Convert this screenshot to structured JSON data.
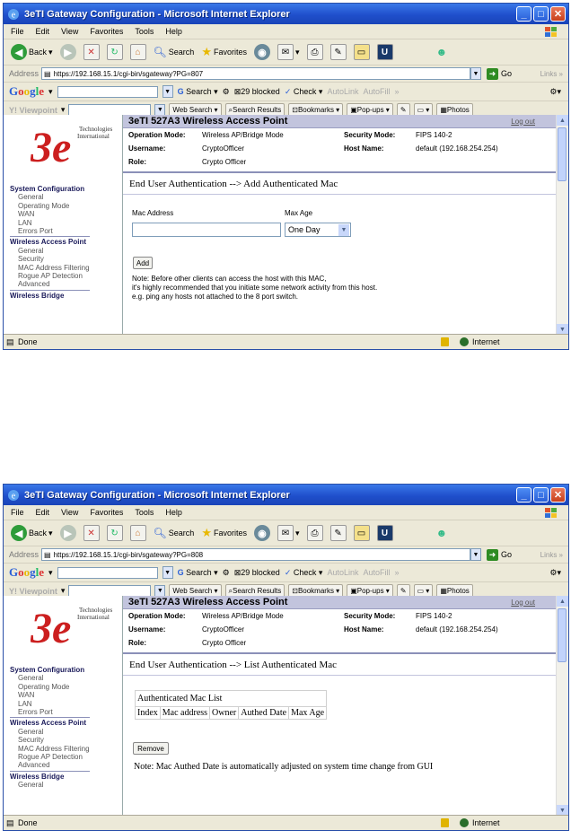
{
  "windows": [
    {
      "title": "3eTI Gateway Configuration - Microsoft Internet Explorer",
      "menu": [
        "File",
        "Edit",
        "View",
        "Favorites",
        "Tools",
        "Help"
      ],
      "toolbar": {
        "back": "Back",
        "search": "Search",
        "favorites": "Favorites"
      },
      "address": {
        "label": "Address",
        "url": "https://192.168.15.1/cgi-bin/sgateway?PG=807",
        "go": "Go",
        "links": "Links"
      },
      "google": {
        "logo": "Google",
        "search": "Search",
        "blocked": "29 blocked",
        "check": "Check",
        "autolink": "AutoLink",
        "autofill": "AutoFill"
      },
      "yahoo": {
        "logo": "Y! Viewpoint",
        "websearch": "Web Search",
        "results": "Search Results",
        "bookmarks": "Bookmarks",
        "popups": "Pop-ups",
        "photos": "Photos"
      },
      "status": {
        "left": "Done",
        "zone": "Internet"
      },
      "page": {
        "logo_text": "Technologies International",
        "logo_mark": "3e",
        "header_title": "3eTI 527A3 Wireless Access Point",
        "logout": "Log out",
        "info": {
          "op_mode_label": "Operation Mode:",
          "op_mode_value": "Wireless AP/Bridge Mode",
          "user_label": "Username:",
          "user_value": "CryptoOfficer",
          "role_label": "Role:",
          "role_value": "Crypto Officer",
          "sec_label": "Security Mode:",
          "sec_value": "FIPS 140-2",
          "host_label": "Host Name:",
          "host_value": "default (192.168.254.254)"
        },
        "nav": [
          {
            "type": "hd",
            "label": "System Configuration"
          },
          {
            "type": "it",
            "label": "General"
          },
          {
            "type": "it",
            "label": "Operating Mode"
          },
          {
            "type": "it",
            "label": "WAN"
          },
          {
            "type": "it",
            "label": "LAN"
          },
          {
            "type": "it",
            "label": "Errors Port"
          },
          {
            "type": "hd",
            "label": "Wireless Access Point"
          },
          {
            "type": "it",
            "label": "General"
          },
          {
            "type": "it",
            "label": "Security"
          },
          {
            "type": "it",
            "label": "MAC Address Filtering"
          },
          {
            "type": "it",
            "label": "Rogue AP Detection"
          },
          {
            "type": "it",
            "label": "Advanced"
          },
          {
            "type": "hd",
            "label": "Wireless Bridge"
          }
        ],
        "section_title": "End User Authentication --> Add Authenticated Mac",
        "mac_label": "Mac Address",
        "mac_value": "",
        "age_label": "Max Age",
        "age_value": "One Day",
        "add_button": "Add",
        "note_lines": [
          "Note: Before other clients can access the host with this MAC,",
          "it's highly recommended that you initiate some network activity from this host.",
          "e.g. ping any hosts not attached to the 8 port switch."
        ]
      }
    },
    {
      "title": "3eTI Gateway Configuration - Microsoft Internet Explorer",
      "menu": [
        "File",
        "Edit",
        "View",
        "Favorites",
        "Tools",
        "Help"
      ],
      "toolbar": {
        "back": "Back",
        "search": "Search",
        "favorites": "Favorites"
      },
      "address": {
        "label": "Address",
        "url": "https://192.168.15.1/cgi-bin/sgateway?PG=808",
        "go": "Go",
        "links": "Links"
      },
      "google": {
        "logo": "Google",
        "search": "Search",
        "blocked": "29 blocked",
        "check": "Check",
        "autolink": "AutoLink",
        "autofill": "AutoFill"
      },
      "yahoo": {
        "logo": "Y! Viewpoint",
        "websearch": "Web Search",
        "results": "Search Results",
        "bookmarks": "Bookmarks",
        "popups": "Pop-ups",
        "photos": "Photos"
      },
      "status": {
        "left": "Done",
        "zone": "Internet"
      },
      "page": {
        "logo_text": "Technologies International",
        "logo_mark": "3e",
        "header_title": "3eTI 527A3 Wireless Access Point",
        "logout": "Log out",
        "info": {
          "op_mode_label": "Operation Mode:",
          "op_mode_value": "Wireless AP/Bridge Mode",
          "user_label": "Username:",
          "user_value": "CryptoOfficer",
          "role_label": "Role:",
          "role_value": "Crypto Officer",
          "sec_label": "Security Mode:",
          "sec_value": "FIPS 140-2",
          "host_label": "Host Name:",
          "host_value": "default (192.168.254.254)"
        },
        "nav": [
          {
            "type": "hd",
            "label": "System Configuration"
          },
          {
            "type": "it",
            "label": "General"
          },
          {
            "type": "it",
            "label": "Operating Mode"
          },
          {
            "type": "it",
            "label": "WAN"
          },
          {
            "type": "it",
            "label": "LAN"
          },
          {
            "type": "it",
            "label": "Errors Port"
          },
          {
            "type": "hd",
            "label": "Wireless Access Point"
          },
          {
            "type": "it",
            "label": "General"
          },
          {
            "type": "it",
            "label": "Security"
          },
          {
            "type": "it",
            "label": "MAC Address Filtering"
          },
          {
            "type": "it",
            "label": "Rogue AP Detection"
          },
          {
            "type": "it",
            "label": "Advanced"
          },
          {
            "type": "hd",
            "label": "Wireless Bridge"
          },
          {
            "type": "it",
            "label": "General"
          }
        ],
        "section_title": "End User Authentication --> List Authenticated Mac",
        "table_caption": "Authenticated Mac List",
        "table_headers": [
          "Index",
          "Mac address",
          "Owner",
          "Authed Date",
          "Max Age"
        ],
        "remove_button": "Remove",
        "note": "Note: Mac Authed Date is automatically adjusted on system time change from GUI"
      }
    }
  ]
}
